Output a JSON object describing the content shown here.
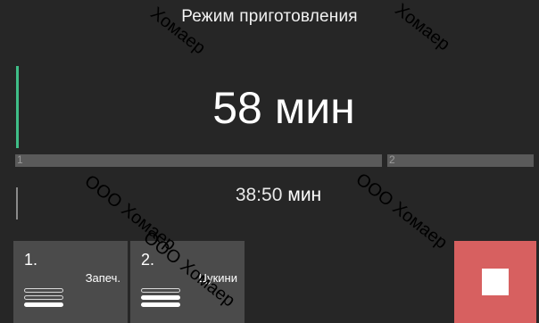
{
  "header": {
    "title": "Режим приготовления"
  },
  "main_timer": {
    "value": "58",
    "unit": "мин"
  },
  "progress": {
    "segments": [
      {
        "label": "1"
      },
      {
        "label": "2"
      }
    ]
  },
  "sub_timer": {
    "value": "38:50",
    "unit": "мин"
  },
  "steps": [
    {
      "index": "1.",
      "name": "Запеч.",
      "level_filled": 1,
      "level_total": 3
    },
    {
      "index": "2.",
      "name": "Цукини",
      "level_filled": 2,
      "level_total": 3
    }
  ],
  "controls": {
    "stop_icon": "stop-icon",
    "stop_color": "#d76060"
  },
  "colors": {
    "background": "#262626",
    "accent": "#3fbe88",
    "card": "#4b4b4b"
  },
  "watermarks": [
    "Хомаер",
    "Хомаер",
    "ООО Хомаер",
    "ООО Хомаер",
    "ООО Хомаер"
  ]
}
